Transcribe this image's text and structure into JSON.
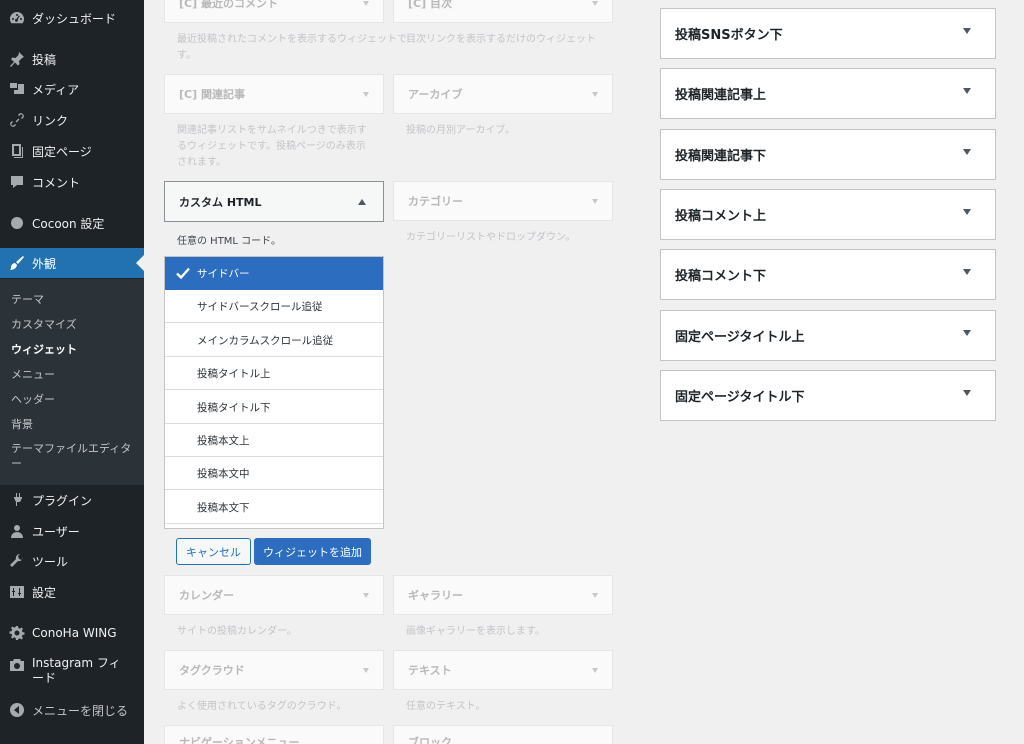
{
  "sidebar": {
    "menu": [
      {
        "label": "ダッシュボード",
        "icon": "dashboard-icon"
      },
      {
        "label": "投稿",
        "icon": "pin-icon"
      },
      {
        "label": "メディア",
        "icon": "media-icon"
      },
      {
        "label": "リンク",
        "icon": "link-icon"
      },
      {
        "label": "固定ページ",
        "icon": "page-icon"
      },
      {
        "label": "コメント",
        "icon": "comment-icon"
      },
      {
        "label": "Cocoon 設定",
        "icon": "circle-icon"
      },
      {
        "label": "外観",
        "icon": "brush-icon"
      },
      {
        "label": "プラグイン",
        "icon": "plugin-icon"
      },
      {
        "label": "ユーザー",
        "icon": "user-icon"
      },
      {
        "label": "ツール",
        "icon": "wrench-icon"
      },
      {
        "label": "設定",
        "icon": "settings-icon"
      },
      {
        "label": "ConoHa WING",
        "icon": "gear-icon"
      },
      {
        "label": "Instagram フィード",
        "icon": "camera-icon"
      },
      {
        "label": "メニューを閉じる",
        "icon": "collapse-icon"
      }
    ],
    "submenu": [
      "テーマ",
      "カスタマイズ",
      "ウィジェット",
      "メニュー",
      "ヘッダー",
      "背景",
      "テーマファイルエディター"
    ]
  },
  "widgets": {
    "top_left": {
      "title": "[C] 最近のコメント",
      "desc": "最近投稿されたコメントを表示するウィジェットです。"
    },
    "top_right": {
      "title": "[C] 目次",
      "desc": "目次リンクを表示するだけのウィジェット"
    },
    "related": {
      "title": "[C] 関連記事",
      "desc": "関連記事リストをサムネイルつきで表示するウィジェットです。投稿ページのみ表示されます。"
    },
    "archive": {
      "title": "アーカイブ",
      "desc": "投稿の月別アーカイブ。"
    },
    "custom_html": {
      "title": "カスタム HTML",
      "desc": "任意の HTML コード。"
    },
    "category": {
      "title": "カテゴリー",
      "desc": "カテゴリーリストやドロップダウン。"
    },
    "calendar": {
      "title": "カレンダー",
      "desc": "サイトの投稿カレンダー。"
    },
    "gallery": {
      "title": "ギャラリー",
      "desc": "画像ギャラリーを表示します。"
    },
    "tagcloud": {
      "title": "タグクラウド",
      "desc": "よく使用されているタグのクラウド。"
    },
    "text": {
      "title": "テキスト",
      "desc": "任意のテキスト。"
    },
    "bottom_left": {
      "title": "ナビゲーションメニュー"
    },
    "bottom_right": {
      "title": "ブロック"
    }
  },
  "chooser": {
    "options": [
      "サイドバー",
      "サイドバースクロール追従",
      "メインカラムスクロール追従",
      "投稿タイトル上",
      "投稿タイトル下",
      "投稿本文上",
      "投稿本文中",
      "投稿本文下"
    ],
    "selected_index": 0,
    "cancel_label": "キャンセル",
    "add_label": "ウィジェットを追加"
  },
  "areas": [
    "投稿SNSボタン下",
    "投稿関連記事上",
    "投稿関連記事下",
    "投稿コメント上",
    "投稿コメント下",
    "固定ページタイトル上",
    "固定ページタイトル下"
  ],
  "colors": {
    "admin_bar": "#1d2327",
    "accent": "#2271b1",
    "selected": "#2c6dbf"
  }
}
